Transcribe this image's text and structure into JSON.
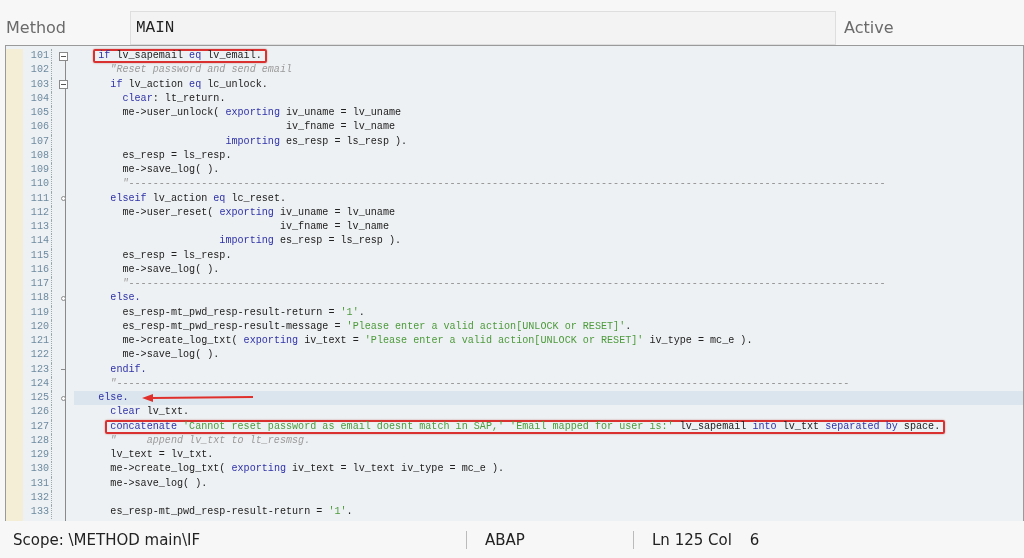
{
  "header": {
    "label": "Method",
    "value": "MAIN",
    "status": "Active"
  },
  "lines": [
    {
      "number": "101",
      "kind": "minus",
      "current": false,
      "boxed": true,
      "arrow": false,
      "segments": [
        {
          "kind": "kw",
          "text": "    if"
        },
        {
          "kind": "txt",
          "text": " lv_sapemail "
        },
        {
          "kind": "kw",
          "text": "eq"
        },
        {
          "kind": "txt",
          "text": " lv_email."
        }
      ]
    },
    {
      "number": "102",
      "current": false,
      "boxed": false,
      "arrow": false,
      "segments": [
        {
          "kind": "cmt",
          "text": "      \"Reset password and send email"
        }
      ]
    },
    {
      "number": "103",
      "kind": "minus",
      "current": false,
      "boxed": false,
      "arrow": false,
      "segments": [
        {
          "kind": "kw",
          "text": "      if"
        },
        {
          "kind": "txt",
          "text": " lv_action "
        },
        {
          "kind": "kw",
          "text": "eq"
        },
        {
          "kind": "txt",
          "text": " lc_unlock."
        }
      ]
    },
    {
      "number": "104",
      "current": false,
      "boxed": false,
      "arrow": false,
      "segments": [
        {
          "kind": "kw",
          "text": "        clear"
        },
        {
          "kind": "txt",
          "text": ": lt_return."
        }
      ]
    },
    {
      "number": "105",
      "current": false,
      "boxed": false,
      "arrow": false,
      "segments": [
        {
          "kind": "txt",
          "text": "        me->user_unlock( "
        },
        {
          "kind": "kw",
          "text": "exporting"
        },
        {
          "kind": "txt",
          "text": " iv_uname = lv_uname"
        }
      ]
    },
    {
      "number": "106",
      "current": false,
      "boxed": false,
      "arrow": false,
      "segments": [
        {
          "kind": "txt",
          "text": "                                   iv_fname = lv_name"
        }
      ]
    },
    {
      "number": "107",
      "current": false,
      "boxed": false,
      "arrow": false,
      "segments": [
        {
          "kind": "kw",
          "text": "                         importing"
        },
        {
          "kind": "txt",
          "text": " es_resp = ls_resp )."
        }
      ]
    },
    {
      "number": "108",
      "current": false,
      "boxed": false,
      "arrow": false,
      "segments": [
        {
          "kind": "txt",
          "text": "        es_resp = ls_resp."
        }
      ]
    },
    {
      "number": "109",
      "current": false,
      "boxed": false,
      "arrow": false,
      "segments": [
        {
          "kind": "txt",
          "text": "        me->save_log( )."
        }
      ]
    },
    {
      "number": "110",
      "current": false,
      "boxed": false,
      "arrow": false,
      "segments": [
        {
          "kind": "cmt",
          "text": "        \"-----------------------------------------------------------------------------------------------------------------------------"
        }
      ]
    },
    {
      "number": "111",
      "kind": "dot",
      "current": false,
      "boxed": false,
      "arrow": false,
      "segments": [
        {
          "kind": "kw",
          "text": "      elseif"
        },
        {
          "kind": "txt",
          "text": " lv_action "
        },
        {
          "kind": "kw",
          "text": "eq"
        },
        {
          "kind": "txt",
          "text": " lc_reset."
        }
      ]
    },
    {
      "number": "112",
      "current": false,
      "boxed": false,
      "arrow": false,
      "segments": [
        {
          "kind": "txt",
          "text": "        me->user_reset( "
        },
        {
          "kind": "kw",
          "text": "exporting"
        },
        {
          "kind": "txt",
          "text": " iv_uname = lv_uname"
        }
      ]
    },
    {
      "number": "113",
      "current": false,
      "boxed": false,
      "arrow": false,
      "segments": [
        {
          "kind": "txt",
          "text": "                                  iv_fname = lv_name"
        }
      ]
    },
    {
      "number": "114",
      "current": false,
      "boxed": false,
      "arrow": false,
      "segments": [
        {
          "kind": "kw",
          "text": "                        importing"
        },
        {
          "kind": "txt",
          "text": " es_resp = ls_resp )."
        }
      ]
    },
    {
      "number": "115",
      "current": false,
      "boxed": false,
      "arrow": false,
      "segments": [
        {
          "kind": "txt",
          "text": "        es_resp = ls_resp."
        }
      ]
    },
    {
      "number": "116",
      "current": false,
      "boxed": false,
      "arrow": false,
      "segments": [
        {
          "kind": "txt",
          "text": "        me->save_log( )."
        }
      ]
    },
    {
      "number": "117",
      "current": false,
      "boxed": false,
      "arrow": false,
      "segments": [
        {
          "kind": "cmt",
          "text": "        \"-----------------------------------------------------------------------------------------------------------------------------"
        }
      ]
    },
    {
      "number": "118",
      "kind": "dot",
      "current": false,
      "boxed": false,
      "arrow": false,
      "segments": [
        {
          "kind": "kw",
          "text": "      else."
        }
      ]
    },
    {
      "number": "119",
      "current": false,
      "boxed": false,
      "arrow": false,
      "segments": [
        {
          "kind": "txt",
          "text": "        es_resp-mt_pwd_resp-result-return = "
        },
        {
          "kind": "str",
          "text": "'1'"
        },
        {
          "kind": "txt",
          "text": "."
        }
      ]
    },
    {
      "number": "120",
      "current": false,
      "boxed": false,
      "arrow": false,
      "segments": [
        {
          "kind": "txt",
          "text": "        es_resp-mt_pwd_resp-result-message = "
        },
        {
          "kind": "str",
          "text": "'Please enter a valid action[UNLOCK or RESET]'"
        },
        {
          "kind": "txt",
          "text": "."
        }
      ]
    },
    {
      "number": "121",
      "current": false,
      "boxed": false,
      "arrow": false,
      "segments": [
        {
          "kind": "txt",
          "text": "        me->create_log_txt( "
        },
        {
          "kind": "kw",
          "text": "exporting"
        },
        {
          "kind": "txt",
          "text": " iv_text = "
        },
        {
          "kind": "str",
          "text": "'Please enter a valid action[UNLOCK or RESET]'"
        },
        {
          "kind": "txt",
          "text": " iv_type = mc_e )."
        }
      ]
    },
    {
      "number": "122",
      "current": false,
      "boxed": false,
      "arrow": false,
      "segments": [
        {
          "kind": "txt",
          "text": "        me->save_log( )."
        }
      ]
    },
    {
      "number": "123",
      "kind": "end",
      "current": false,
      "boxed": false,
      "arrow": false,
      "segments": [
        {
          "kind": "kw",
          "text": "      endif."
        }
      ]
    },
    {
      "number": "124",
      "current": false,
      "boxed": false,
      "arrow": false,
      "segments": [
        {
          "kind": "cmt",
          "text": "      \"-------------------------------------------------------------------------------------------------------------------------"
        }
      ]
    },
    {
      "number": "125",
      "kind": "dot",
      "current": true,
      "boxed": false,
      "arrow": true,
      "segments": [
        {
          "kind": "kw",
          "text": "    else."
        }
      ]
    },
    {
      "number": "126",
      "current": false,
      "boxed": false,
      "arrow": false,
      "segments": [
        {
          "kind": "kw",
          "text": "      clear"
        },
        {
          "kind": "txt",
          "text": " lv_txt."
        }
      ]
    },
    {
      "number": "127",
      "current": false,
      "boxed": true,
      "arrow": false,
      "segments": [
        {
          "kind": "kw",
          "text": "      concatenate"
        },
        {
          "kind": "str",
          "text": " 'Cannot reset password as email doesnt match in SAP,'"
        },
        {
          "kind": "str",
          "text": " 'Email mapped for user is:'"
        },
        {
          "kind": "txt",
          "text": " lv_sapemail "
        },
        {
          "kind": "kw",
          "text": "into"
        },
        {
          "kind": "txt",
          "text": " lv_txt "
        },
        {
          "kind": "kw",
          "text": "separated by"
        },
        {
          "kind": "txt",
          "text": " space."
        }
      ]
    },
    {
      "number": "128",
      "current": false,
      "boxed": false,
      "arrow": false,
      "segments": [
        {
          "kind": "cmt",
          "text": "      \"     append lv_txt to lt_resmsg."
        }
      ]
    },
    {
      "number": "129",
      "current": false,
      "boxed": false,
      "arrow": false,
      "segments": [
        {
          "kind": "txt",
          "text": "      lv_text = lv_txt."
        }
      ]
    },
    {
      "number": "130",
      "current": false,
      "boxed": false,
      "arrow": false,
      "segments": [
        {
          "kind": "txt",
          "text": "      me->create_log_txt( "
        },
        {
          "kind": "kw",
          "text": "exporting"
        },
        {
          "kind": "txt",
          "text": " iv_text = lv_text iv_type = mc_e )."
        }
      ]
    },
    {
      "number": "131",
      "current": false,
      "boxed": false,
      "arrow": false,
      "segments": [
        {
          "kind": "txt",
          "text": "      me->save_log( )."
        }
      ]
    },
    {
      "number": "132",
      "current": false,
      "boxed": false,
      "arrow": false
    },
    {
      "number": "133",
      "current": false,
      "boxed": false,
      "arrow": false,
      "segments": [
        {
          "kind": "txt",
          "text": "      es_resp-mt_pwd_resp-result-return = "
        },
        {
          "kind": "str",
          "text": "'1'"
        },
        {
          "kind": "txt",
          "text": "."
        }
      ]
    }
  ],
  "status_bar": {
    "scope": "Scope: \\METHOD main\\IF",
    "language": "ABAP",
    "position": "Ln 125 Col",
    "column": "6"
  }
}
